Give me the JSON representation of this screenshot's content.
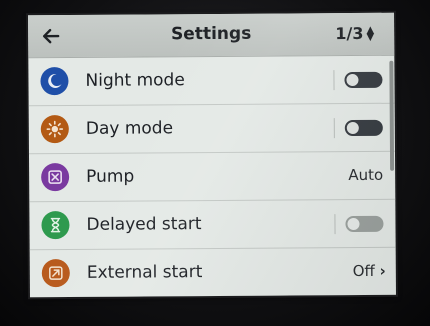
{
  "header": {
    "title": "Settings",
    "page_indicator": "1/3",
    "back_icon": "arrow-left-icon",
    "pager_icon": "up-down-arrows-icon"
  },
  "settings": [
    {
      "label": "Night mode",
      "icon": "moon-icon",
      "icon_color": "#1f4fa8",
      "control": "toggle",
      "toggle_on": false,
      "enabled": true
    },
    {
      "label": "Day mode",
      "icon": "sun-icon",
      "icon_color": "#b35a14",
      "control": "toggle",
      "toggle_on": false,
      "enabled": true
    },
    {
      "label": "Pump",
      "icon": "pump-icon",
      "icon_color": "#7a3aa0",
      "control": "value",
      "value": "Auto"
    },
    {
      "label": "Delayed start",
      "icon": "hourglass-icon",
      "icon_color": "#2e9a4e",
      "control": "toggle",
      "toggle_on": false,
      "enabled": false
    },
    {
      "label": "External start",
      "icon": "external-start-icon",
      "icon_color": "#b85a1c",
      "control": "value",
      "value": "Off",
      "chevron": "chevron-right-icon"
    }
  ]
}
